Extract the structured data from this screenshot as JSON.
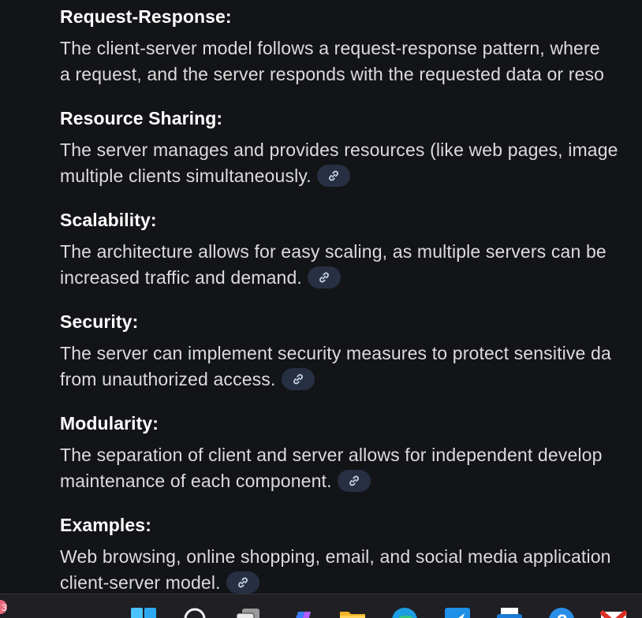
{
  "sections": [
    {
      "heading": "Request-Response:",
      "lines": [
        "The client-server model follows a request-response pattern, where",
        "a request, and the server responds with the requested data or reso"
      ],
      "has_link": false
    },
    {
      "heading": "Resource Sharing:",
      "lines": [
        "The server manages and provides resources (like web pages, image",
        "multiple clients simultaneously."
      ],
      "has_link": true
    },
    {
      "heading": "Scalability:",
      "lines": [
        "The architecture allows for easy scaling, as multiple servers can be",
        "increased traffic and demand."
      ],
      "has_link": true
    },
    {
      "heading": "Security:",
      "lines": [
        "The server can implement security measures to protect sensitive da",
        "from unauthorized access."
      ],
      "has_link": true
    },
    {
      "heading": "Modularity:",
      "lines": [
        "The separation of client and server allows for independent develop",
        "maintenance of each component."
      ],
      "has_link": true
    },
    {
      "heading": "Examples:",
      "lines": [
        "Web browsing, online shopping, email, and social media application",
        "client-server model."
      ],
      "has_link": true
    }
  ],
  "icons": {
    "link": "link-icon"
  },
  "taskbar": {
    "apps": [
      "windows-start-icon",
      "search-icon",
      "task-view-icon",
      "copilot-icon",
      "file-explorer-icon",
      "edge-browser-icon",
      "store-icon",
      "printer-icon",
      "help-icon",
      "gmail-icon"
    ]
  },
  "colors": {
    "background": "#131418",
    "heading": "#ffffff",
    "body_text": "#dcdcdc",
    "link_chip": "#263042",
    "link_icon": "#c8d4ea",
    "taskbar": "#1f1f24"
  }
}
